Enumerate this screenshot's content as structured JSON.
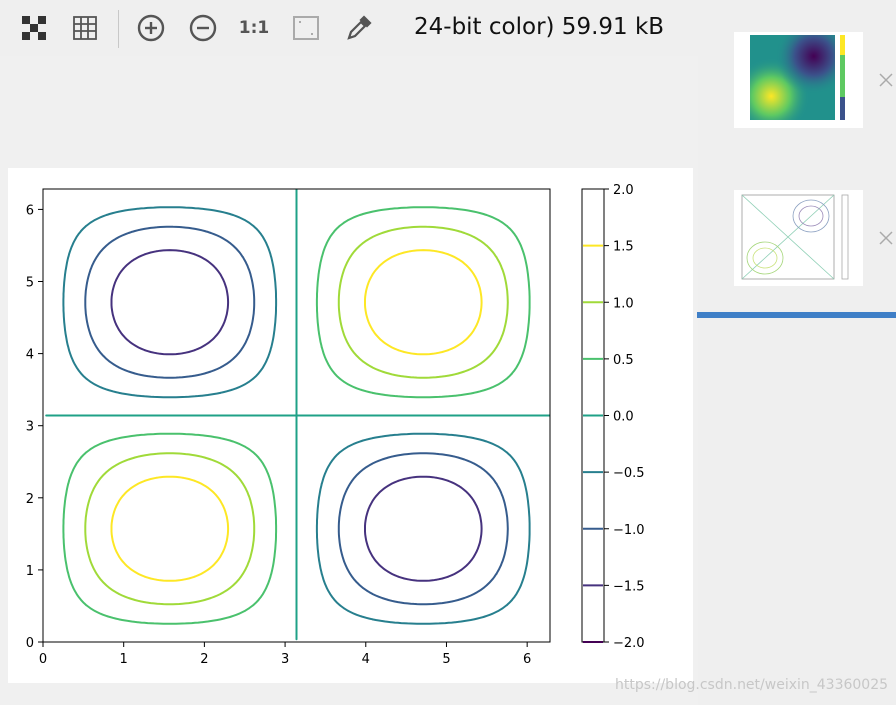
{
  "toolbar": {
    "info_text": "24-bit color) 59.91 kB",
    "buttons": [
      {
        "name": "chessboard-icon"
      },
      {
        "name": "grid-icon"
      },
      {
        "name": "zoom-in-icon"
      },
      {
        "name": "zoom-out-icon"
      },
      {
        "name": "actual-size-icon",
        "label": "1:1"
      },
      {
        "name": "fit-screen-icon"
      },
      {
        "name": "color-picker-icon"
      }
    ]
  },
  "sidepanel": {
    "thumbnails": [
      {
        "name": "thumbnail-heatmap",
        "close_icon": "close-icon"
      },
      {
        "name": "thumbnail-contour",
        "close_icon": "close-icon"
      }
    ]
  },
  "watermark": "https://blog.csdn.net/weixin_43360025",
  "chart_data": {
    "type": "contour",
    "function": "sin(x) * sin(y) * 2",
    "x_ticks": [
      "0",
      "1",
      "2",
      "3",
      "4",
      "5",
      "6"
    ],
    "y_ticks": [
      "0",
      "1",
      "2",
      "3",
      "4",
      "5",
      "6"
    ],
    "xlim": [
      0,
      6.283
    ],
    "ylim": [
      0,
      6.283
    ],
    "levels": [
      -1.5,
      -1.0,
      -0.5,
      0.0,
      0.5,
      1.0,
      1.5
    ],
    "colorbar": {
      "ticks": [
        "2.0",
        "1.5",
        "1.0",
        "0.5",
        "0.0",
        "−0.5",
        "−1.0",
        "−1.5",
        "−2.0"
      ],
      "range": [
        -2.0,
        2.0
      ]
    },
    "colors": {
      "-2.0": "#440154",
      "-1.5": "#46327e",
      "-1.0": "#365c8d",
      "-0.5": "#277f8e",
      "0.0": "#1fa187",
      "0.5": "#4ac16d",
      "1.0": "#a0da39",
      "1.5": "#fde725"
    }
  }
}
